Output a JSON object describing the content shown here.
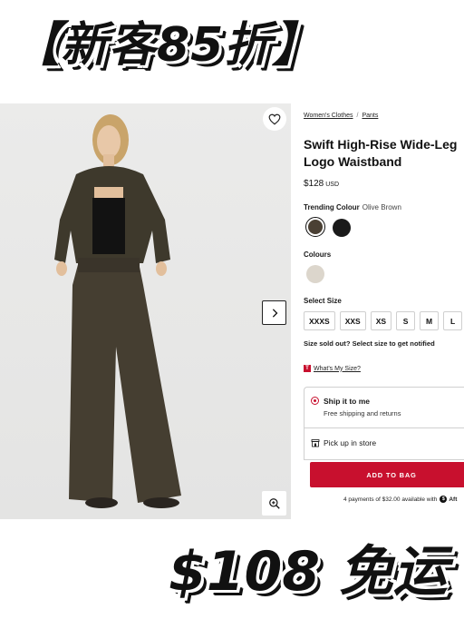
{
  "promo": {
    "top_text": "【新客85折】",
    "bottom_text": "$108 免运"
  },
  "breadcrumb": [
    "Women's Clothes",
    "Pants"
  ],
  "product": {
    "title": "Swift High-Rise Wide-Leg Logo Waistband",
    "price": "$128",
    "currency": "USD"
  },
  "trending_colour": {
    "label": "Trending Colour",
    "value": "Olive Brown",
    "swatches": [
      "#4a4034",
      "#1a1a1a"
    ]
  },
  "colours": {
    "label": "Colours",
    "swatches": [
      "#dcd6cc"
    ]
  },
  "sizes": {
    "label": "Select Size",
    "options": [
      "XXXS",
      "XXS",
      "XS",
      "S",
      "M",
      "L"
    ]
  },
  "sold_out_text": "Size sold out? Select size to get notified",
  "whats_my_size": "What's My Size?",
  "shipping": {
    "ship_title": "Ship it to me",
    "ship_sub": "Free shipping and returns",
    "pickup": "Pick up in store"
  },
  "add_to_bag": "ADD TO BAG",
  "installments": {
    "text": "4 payments of $32.00 available with",
    "brand": "Aft"
  },
  "colors": {
    "accent": "#c8102e"
  },
  "icons": {
    "wishlist": "heart-icon",
    "next": "chevron-right-icon",
    "zoom": "zoom-in-icon",
    "store": "store-icon",
    "size_guide": "t-logo-icon"
  }
}
